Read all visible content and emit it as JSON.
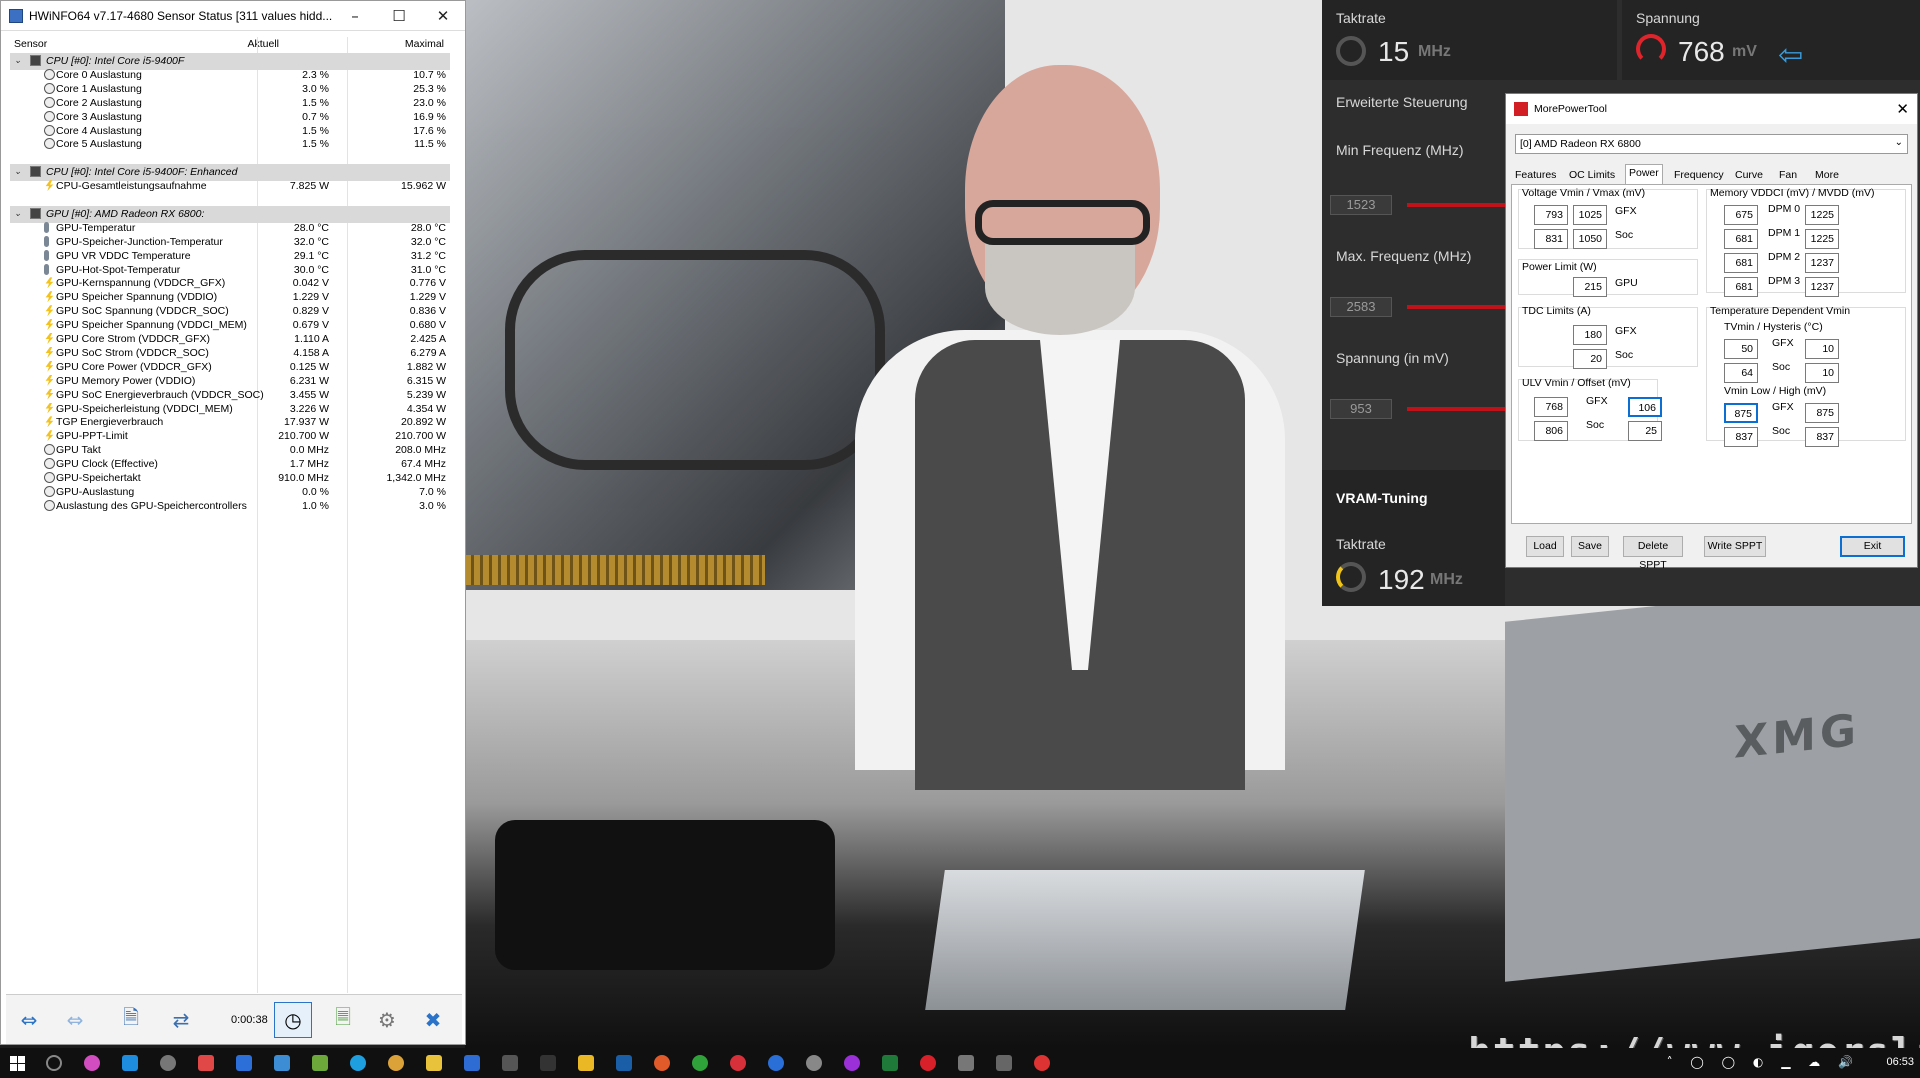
{
  "hwinfo": {
    "title": "HWiNFO64 v7.17-4680 Sensor Status [311 values hidd...",
    "columns": {
      "sensor": "Sensor",
      "current": "Aktuell",
      "max": "Maximal"
    },
    "groups": [
      {
        "title": "CPU [#0]: Intel Core i5-9400F",
        "rows": [
          {
            "label": "Core 0 Auslastung",
            "current": "2.3 %",
            "max": "10.7 %",
            "icon": "clock"
          },
          {
            "label": "Core 1 Auslastung",
            "current": "3.0 %",
            "max": "25.3 %",
            "icon": "clock"
          },
          {
            "label": "Core 2 Auslastung",
            "current": "1.5 %",
            "max": "23.0 %",
            "icon": "clock"
          },
          {
            "label": "Core 3 Auslastung",
            "current": "0.7 %",
            "max": "16.9 %",
            "icon": "clock"
          },
          {
            "label": "Core 4 Auslastung",
            "current": "1.5 %",
            "max": "17.6 %",
            "icon": "clock"
          },
          {
            "label": "Core 5 Auslastung",
            "current": "1.5 %",
            "max": "11.5 %",
            "icon": "clock"
          }
        ]
      },
      {
        "title": "CPU [#0]: Intel Core i5-9400F: Enhanced",
        "rows": [
          {
            "label": "CPU-Gesamtleistungsaufnahme",
            "current": "7.825 W",
            "max": "15.962 W",
            "icon": "bolt"
          }
        ]
      },
      {
        "title": "GPU [#0]: AMD Radeon RX 6800:",
        "rows": [
          {
            "label": "GPU-Temperatur",
            "current": "28.0 °C",
            "max": "28.0 °C",
            "icon": "therm"
          },
          {
            "label": "GPU-Speicher-Junction-Temperatur",
            "current": "32.0 °C",
            "max": "32.0 °C",
            "icon": "therm"
          },
          {
            "label": "GPU VR VDDC Temperature",
            "current": "29.1 °C",
            "max": "31.2 °C",
            "icon": "therm"
          },
          {
            "label": "GPU-Hot-Spot-Temperatur",
            "current": "30.0 °C",
            "max": "31.0 °C",
            "icon": "therm"
          },
          {
            "label": "GPU-Kernspannung (VDDCR_GFX)",
            "current": "0.042 V",
            "max": "0.776 V",
            "icon": "bolt"
          },
          {
            "label": "GPU Speicher Spannung (VDDIO)",
            "current": "1.229 V",
            "max": "1.229 V",
            "icon": "bolt"
          },
          {
            "label": "GPU SoC Spannung (VDDCR_SOC)",
            "current": "0.829 V",
            "max": "0.836 V",
            "icon": "bolt"
          },
          {
            "label": "GPU Speicher Spannung (VDDCI_MEM)",
            "current": "0.679 V",
            "max": "0.680 V",
            "icon": "bolt"
          },
          {
            "label": "GPU Core Strom (VDDCR_GFX)",
            "current": "1.110 A",
            "max": "2.425 A",
            "icon": "bolt"
          },
          {
            "label": "GPU SoC Strom (VDDCR_SOC)",
            "current": "4.158 A",
            "max": "6.279 A",
            "icon": "bolt"
          },
          {
            "label": "GPU Core Power (VDDCR_GFX)",
            "current": "0.125 W",
            "max": "1.882 W",
            "icon": "bolt"
          },
          {
            "label": "GPU Memory Power (VDDIO)",
            "current": "6.231 W",
            "max": "6.315 W",
            "icon": "bolt"
          },
          {
            "label": "GPU SoC Energieverbrauch (VDDCR_SOC)",
            "current": "3.455 W",
            "max": "5.239 W",
            "icon": "bolt"
          },
          {
            "label": "GPU-Speicherleistung (VDDCI_MEM)",
            "current": "3.226 W",
            "max": "4.354 W",
            "icon": "bolt"
          },
          {
            "label": "TGP Energieverbrauch",
            "current": "17.937 W",
            "max": "20.892 W",
            "icon": "bolt"
          },
          {
            "label": "GPU-PPT-Limit",
            "current": "210.700 W",
            "max": "210.700 W",
            "icon": "bolt"
          },
          {
            "label": "GPU Takt",
            "current": "0.0 MHz",
            "max": "208.0 MHz",
            "icon": "clock"
          },
          {
            "label": "GPU Clock (Effective)",
            "current": "1.7 MHz",
            "max": "67.4 MHz",
            "icon": "clock"
          },
          {
            "label": "GPU-Speichertakt",
            "current": "910.0 MHz",
            "max": "1,342.0 MHz",
            "icon": "clock"
          },
          {
            "label": "GPU-Auslastung",
            "current": "0.0 %",
            "max": "7.0 %",
            "icon": "clock"
          },
          {
            "label": "Auslastung des GPU-Speichercontrollers",
            "current": "1.0 %",
            "max": "3.0 %",
            "icon": "clock"
          }
        ]
      }
    ],
    "toolbar": {
      "timer": "0:00:38"
    }
  },
  "amd_panel": {
    "clock_label": "Taktrate",
    "clock_value": "15",
    "clock_unit": "MHz",
    "voltage_label": "Spannung",
    "voltage_value": "768",
    "voltage_unit": "mV",
    "advanced_label": "Erweiterte Steuerung",
    "min_freq_label": "Min Frequenz (MHz)",
    "min_freq_value": "1523",
    "max_freq_label": "Max. Frequenz (MHz)",
    "max_freq_value": "2583",
    "voltage_mv_label": "Spannung (in mV)",
    "voltage_mv_value": "953",
    "vram_label": "VRAM-Tuning",
    "vram_clock_label": "Taktrate",
    "vram_clock_value": "192",
    "vram_clock_unit": "MHz",
    "accent_color": "#e0242b"
  },
  "mpt": {
    "title": "MorePowerTool",
    "device": "[0] AMD Radeon RX 6800",
    "tabs": [
      "Features",
      "OC Limits",
      "Power",
      "Frequency",
      "Curve",
      "Fan",
      "More"
    ],
    "active_tab": "Power",
    "voltage": {
      "title": "Voltage Vmin / Vmax (mV)",
      "gfx_label": "GFX",
      "soc_label": "Soc",
      "gfx_min": "793",
      "gfx_max": "1025",
      "soc_min": "831",
      "soc_max": "1050"
    },
    "power_limit": {
      "title": "Power Limit (W)",
      "gpu": "215",
      "gpu_label": "GPU"
    },
    "tdc": {
      "title": "TDC Limits (A)",
      "gfx": "180",
      "gfx_label": "GFX",
      "soc": "20",
      "soc_label": "Soc"
    },
    "ulv": {
      "title": "ULV Vmin / Offset (mV)",
      "gfx_label": "GFX",
      "soc_label": "Soc",
      "gfx_vmin": "768",
      "gfx_offset": "106",
      "soc_vmin": "806",
      "soc_offset": "25"
    },
    "memory": {
      "title": "Memory VDDCI (mV) / MVDD (mV)",
      "dpm": [
        {
          "label": "DPM 0",
          "vddci": "675",
          "mvdd": "1225"
        },
        {
          "label": "DPM 1",
          "vddci": "681",
          "mvdd": "1225"
        },
        {
          "label": "DPM 2",
          "vddci": "681",
          "mvdd": "1237"
        },
        {
          "label": "DPM 3",
          "vddci": "681",
          "mvdd": "1237"
        }
      ]
    },
    "tdv": {
      "title": "Temperature Dependent Vmin",
      "tvmin_title": "TVmin / Hysteris (°C)",
      "gfx_label": "GFX",
      "soc_label": "Soc",
      "gfx_t": "50",
      "gfx_h": "10",
      "soc_t": "64",
      "soc_h": "10",
      "vmin_title": "Vmin Low / High (mV)",
      "gfx_low": "875",
      "gfx_high": "875",
      "soc_low": "837",
      "soc_high": "837"
    },
    "buttons": {
      "load": "Load",
      "save": "Save",
      "delete": "Delete SPPT",
      "write": "Write SPPT",
      "exit": "Exit"
    }
  },
  "photo": {
    "watermark": "https://www.igorslab.de"
  },
  "taskbar": {
    "time": "06:53"
  }
}
